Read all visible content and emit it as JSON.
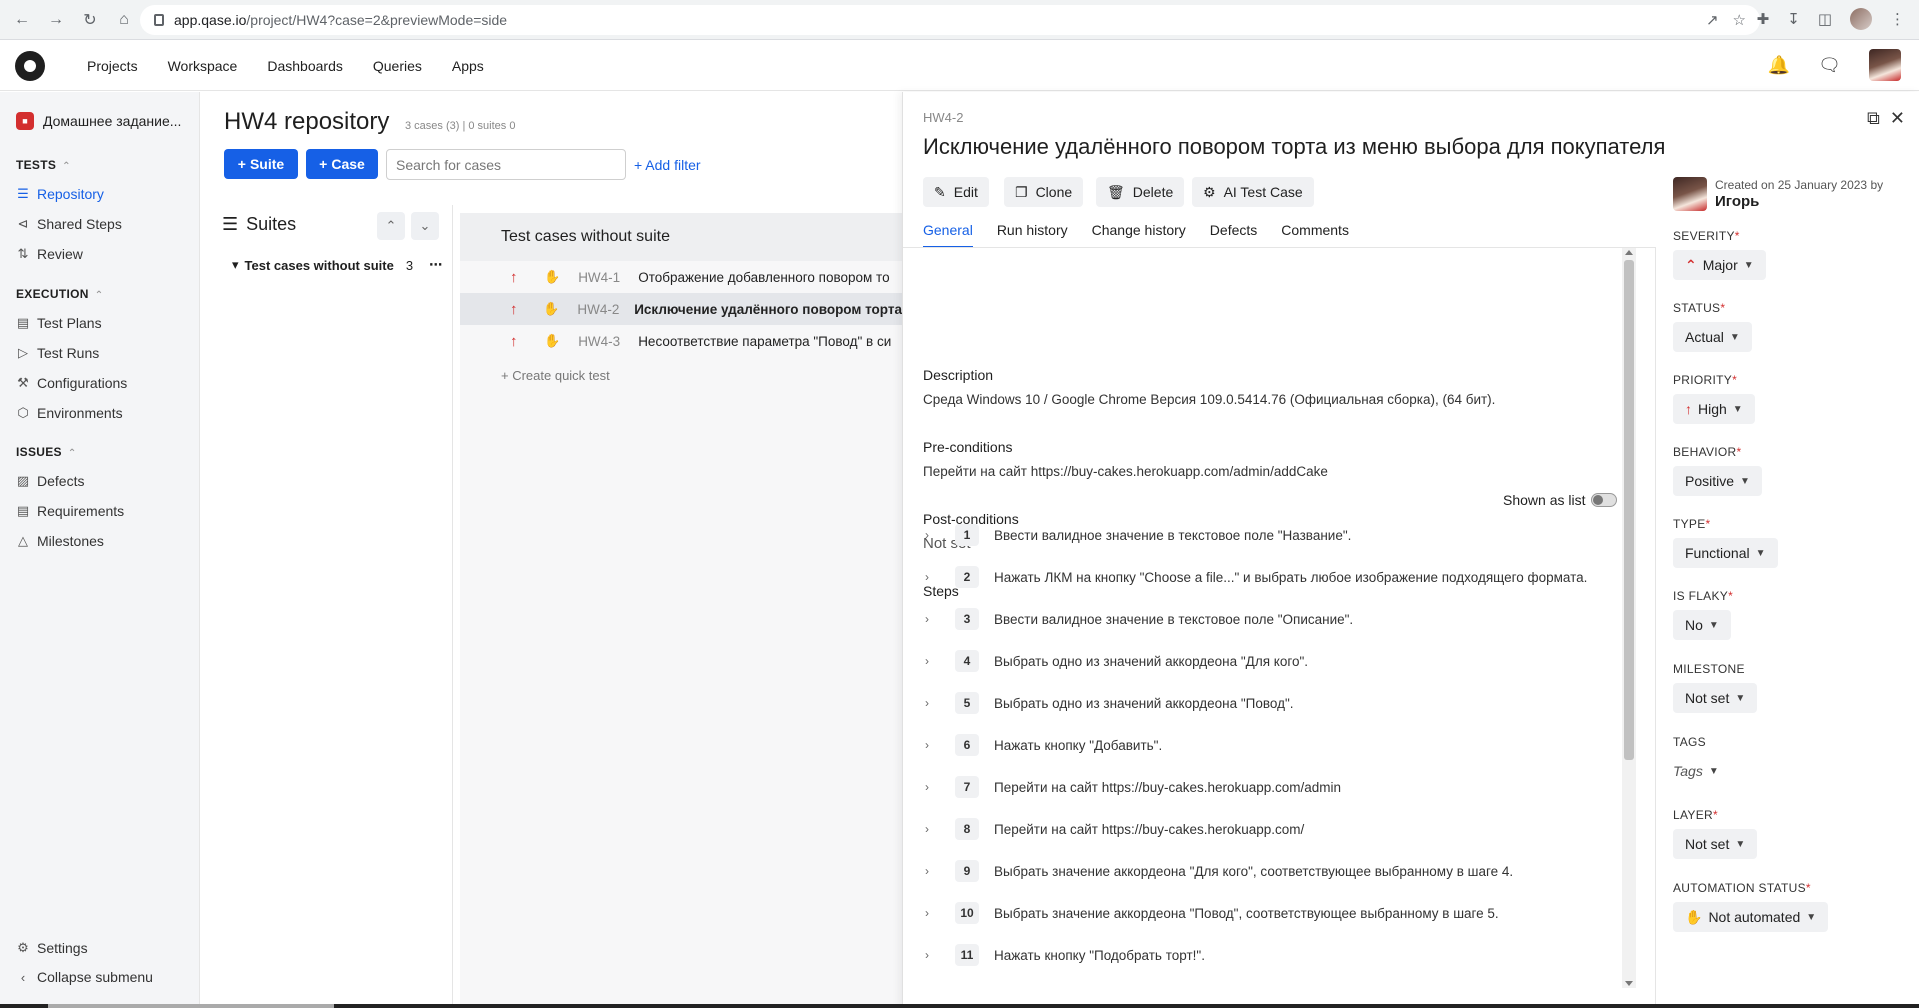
{
  "browser": {
    "url_host": "app.qase.io",
    "url_path": "/project/HW4?case=2&previewMode=side"
  },
  "topnav": {
    "items": [
      "Projects",
      "Workspace",
      "Dashboards",
      "Queries",
      "Apps"
    ]
  },
  "sidebar": {
    "project_name": "Домашнее задание...",
    "sections": {
      "tests": "TESTS",
      "execution": "EXECUTION",
      "issues": "ISSUES"
    },
    "items": {
      "repository": "Repository",
      "shared_steps": "Shared Steps",
      "review": "Review",
      "test_plans": "Test Plans",
      "test_runs": "Test Runs",
      "configurations": "Configurations",
      "environments": "Environments",
      "defects": "Defects",
      "requirements": "Requirements",
      "milestones": "Milestones",
      "settings": "Settings",
      "collapse": "Collapse submenu"
    }
  },
  "repo": {
    "title": "HW4 repository",
    "meta": "3 cases (3) | 0 suites 0",
    "suite_button": "Suite",
    "case_button": "Case",
    "search_placeholder": "Search for cases",
    "add_filter": "+ Add filter",
    "suites_heading": "Suites",
    "suite_name": "Test cases without suite",
    "suite_count": "3",
    "cases_heading": "Test cases without suite",
    "cases": [
      {
        "id": "HW4-1",
        "title": "Отображение добавленного повором то"
      },
      {
        "id": "HW4-2",
        "title": "Исключение удалённого повором торта"
      },
      {
        "id": "HW4-3",
        "title": "Несоответствие параметра \"Повод\" в си"
      }
    ],
    "quick_test": "+ Create quick test"
  },
  "case": {
    "code": "HW4-2",
    "title": "Исключение удалённого повором торта из меню выбора для покупателя",
    "actions": {
      "edit": "Edit",
      "clone": "Clone",
      "delete": "Delete",
      "ai": "AI Test Case"
    },
    "tabs": [
      "General",
      "Run history",
      "Change history",
      "Defects",
      "Comments"
    ],
    "description_label": "Description",
    "description": "Среда Windows 10 / Google Chrome Версия 109.0.5414.76 (Официальная сборка), (64 бит).",
    "preconditions_label": "Pre-conditions",
    "preconditions": "Перейти на сайт https://buy-cakes.herokuapp.com/admin/addCake",
    "postconditions_label": "Post-conditions",
    "postconditions": "Not set",
    "steps_label": "Steps",
    "shown_as_list": "Shown as list",
    "steps": [
      {
        "n": "1",
        "text": "Ввести валидное значение в текстовое поле \"Название\"."
      },
      {
        "n": "2",
        "text": "Нажать ЛКМ на кнопку \"Choose a file...\" и выбрать любое изображение подходящего формата."
      },
      {
        "n": "3",
        "text": "Ввести валидное значение в текстовое поле \"Описание\"."
      },
      {
        "n": "4",
        "text": "Выбрать одно из значений аккордеона \"Для кого\"."
      },
      {
        "n": "5",
        "text": "Выбрать одно из значений аккордеона \"Повод\"."
      },
      {
        "n": "6",
        "text": "Нажать кнопку \"Добавить\"."
      },
      {
        "n": "7",
        "text": "Перейти на сайт https://buy-cakes.herokuapp.com/admin"
      },
      {
        "n": "8",
        "text": "Перейти на сайт https://buy-cakes.herokuapp.com/"
      },
      {
        "n": "9",
        "text": "Выбрать значение аккордеона \"Для кого\", соответствующее выбранному в шаге 4."
      },
      {
        "n": "10",
        "text": "Выбрать значение аккордеона \"Повод\", соответствующее выбранному в шаге 5."
      },
      {
        "n": "11",
        "text": "Нажать кнопку \"Подобрать торт!\"."
      }
    ]
  },
  "props": {
    "created": "Created on 25 January 2023 by",
    "author": "Игорь",
    "severity_label": "SEVERITY",
    "severity": "Major",
    "status_label": "STATUS",
    "status": "Actual",
    "priority_label": "PRIORITY",
    "priority": "High",
    "behavior_label": "BEHAVIOR",
    "behavior": "Positive",
    "type_label": "TYPE",
    "type": "Functional",
    "flaky_label": "IS FLAKY",
    "flaky": "No",
    "milestone_label": "MILESTONE",
    "milestone": "Not set",
    "tags_label": "TAGS",
    "tags": "Tags",
    "layer_label": "LAYER",
    "layer": "Not set",
    "automation_label": "AUTOMATION STATUS",
    "automation": "Not automated"
  },
  "colors": {
    "accent": "#1660e6",
    "priority_red": "#d32f2f"
  }
}
